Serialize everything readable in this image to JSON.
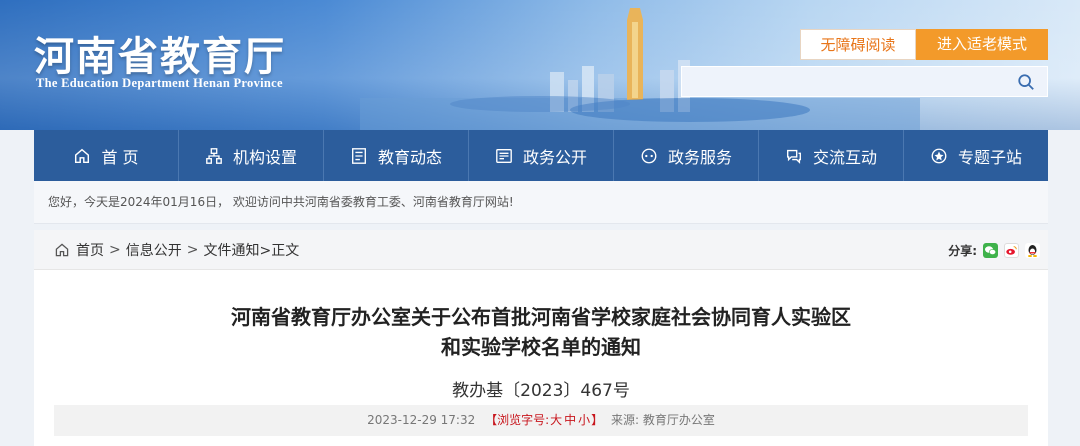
{
  "header": {
    "logo_cn": "河南省教育厅",
    "logo_en": "The Education Department Henan Province",
    "barrier_free": "无障碍阅读",
    "elder_mode": "进入适老模式",
    "search_placeholder": ""
  },
  "nav": [
    {
      "label": "首 页",
      "icon": "home-icon"
    },
    {
      "label": "机构设置",
      "icon": "org-icon"
    },
    {
      "label": "教育动态",
      "icon": "news-icon"
    },
    {
      "label": "政务公开",
      "icon": "gov-open-icon"
    },
    {
      "label": "政务服务",
      "icon": "service-icon"
    },
    {
      "label": "交流互动",
      "icon": "interact-icon"
    },
    {
      "label": "专题子站",
      "icon": "topic-icon"
    }
  ],
  "welcome": "您好，今天是2024年01月16日， 欢迎访问中共河南省委教育工委、河南省教育厅网站!",
  "breadcrumb": {
    "home": "首页",
    "sep": ">",
    "level1": "信息公开",
    "level2": "文件通知",
    "current": ">正文"
  },
  "share": {
    "label": "分享:",
    "icons": [
      "wechat-icon",
      "weibo-icon",
      "qq-icon"
    ]
  },
  "article": {
    "title_line1": "河南省教育厅办公室关于公布首批河南省学校家庭社会协同育人实验区",
    "title_line2": "和实验学校名单的通知",
    "doc_no": "教办基〔2023〕467号",
    "date": "2023-12-29 17:32",
    "font_label_open": "【浏览字号:",
    "size_large": "大",
    "size_medium": "中",
    "size_small": "小",
    "font_label_close": "】",
    "source": "来源: 教育厅办公室"
  },
  "colors": {
    "nav_bg": "#2c5d9c",
    "accent_orange": "#f39a2a",
    "accent_red": "#c8161d"
  }
}
